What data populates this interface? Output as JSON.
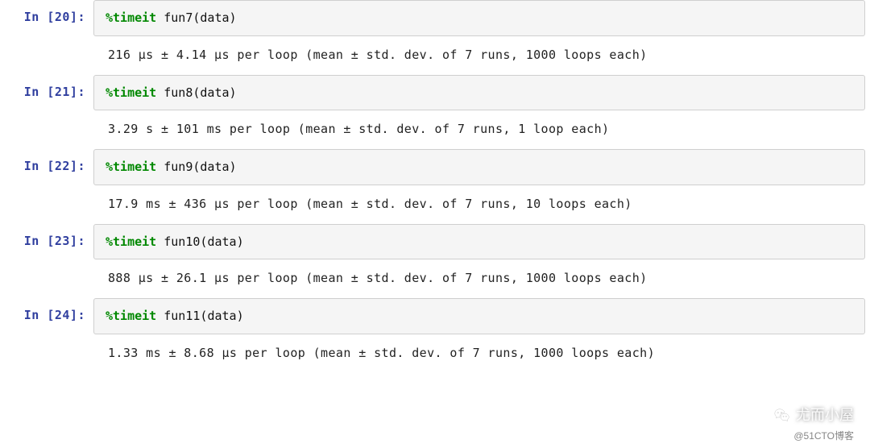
{
  "cells": [
    {
      "prompt": "In [20]:",
      "magic": "%timeit",
      "func": "fun7",
      "arg": "data",
      "output": "216 µs ± 4.14 µs per loop (mean ± std. dev. of 7 runs, 1000 loops each)"
    },
    {
      "prompt": "In [21]:",
      "magic": "%timeit",
      "func": "fun8",
      "arg": "data",
      "output": "3.29 s ± 101 ms per loop (mean ± std. dev. of 7 runs, 1 loop each)"
    },
    {
      "prompt": "In [22]:",
      "magic": "%timeit",
      "func": "fun9",
      "arg": "data",
      "output": "17.9 ms ± 436 µs per loop (mean ± std. dev. of 7 runs, 10 loops each)"
    },
    {
      "prompt": "In [23]:",
      "magic": "%timeit",
      "func": "fun10",
      "arg": "data",
      "output": "888 µs ± 26.1 µs per loop (mean ± std. dev. of 7 runs, 1000 loops each)"
    },
    {
      "prompt": "In [24]:",
      "magic": "%timeit",
      "func": "fun11",
      "arg": "data",
      "output": "1.33 ms ± 8.68 µs per loop (mean ± std. dev. of 7 runs, 1000 loops each)"
    }
  ],
  "watermark": {
    "name": "尤而小屋",
    "sub": "@51CTO博客"
  },
  "colors": {
    "prompt": "#303f9f",
    "codeBg": "#f5f5f5",
    "border": "#cfcfcf",
    "magic": "#008800"
  }
}
